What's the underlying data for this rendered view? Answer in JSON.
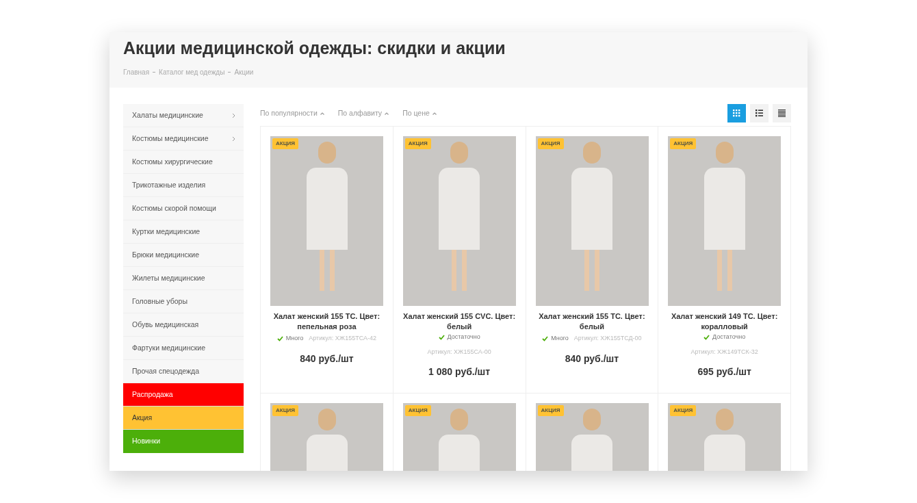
{
  "header": {
    "title": "Акции медицинской одежды: скидки и акции",
    "breadcrumbs": [
      "Главная",
      "Каталог мед одежды",
      "Акции"
    ]
  },
  "sidebar": {
    "items": [
      {
        "label": "Халаты медицинские",
        "kind": "plain",
        "has_submenu": true
      },
      {
        "label": "Костюмы медицинские",
        "kind": "plain",
        "has_submenu": true
      },
      {
        "label": "Костюмы хирургические",
        "kind": "plain",
        "has_submenu": false
      },
      {
        "label": "Трикотажные изделия",
        "kind": "plain",
        "has_submenu": false
      },
      {
        "label": "Костюмы скорой помощи",
        "kind": "plain",
        "has_submenu": false
      },
      {
        "label": "Куртки медицинские",
        "kind": "plain",
        "has_submenu": false
      },
      {
        "label": "Брюки медицинские",
        "kind": "plain",
        "has_submenu": false
      },
      {
        "label": "Жилеты медицинские",
        "kind": "plain",
        "has_submenu": false
      },
      {
        "label": "Головные уборы",
        "kind": "plain",
        "has_submenu": false
      },
      {
        "label": "Обувь медицинская",
        "kind": "plain",
        "has_submenu": false
      },
      {
        "label": "Фартуки медицинские",
        "kind": "plain",
        "has_submenu": false
      },
      {
        "label": "Прочая спецодежда",
        "kind": "plain",
        "has_submenu": false
      },
      {
        "label": "Распродажа",
        "kind": "sale",
        "has_submenu": false
      },
      {
        "label": "Акция",
        "kind": "promo",
        "has_submenu": false
      },
      {
        "label": "Новинки",
        "kind": "new",
        "has_submenu": false
      }
    ]
  },
  "sort_options": [
    {
      "label": "По популярности"
    },
    {
      "label": "По алфавиту"
    },
    {
      "label": "По цене"
    }
  ],
  "view_modes": [
    {
      "kind": "grid",
      "selected": true
    },
    {
      "kind": "list",
      "selected": false
    },
    {
      "kind": "table",
      "selected": false
    }
  ],
  "products": [
    {
      "badge": "АКЦИЯ",
      "kind": "inline",
      "title": "Халат женский 155 ТС. Цвет: пепельная роза",
      "stock": "Много",
      "article": "Артикул: ХЖ155ТСА-42",
      "price": "840 руб./шт"
    },
    {
      "badge": "АКЦИЯ",
      "kind": "stacked",
      "title": "Халат женский 155 CVC. Цвет: белый",
      "stock": "Достаточно",
      "article": "Артикул: ХЖ155СА-00",
      "price": "1 080 руб./шт"
    },
    {
      "badge": "АКЦИЯ",
      "kind": "inline",
      "title": "Халат женский 155 ТС. Цвет: белый",
      "stock": "Много",
      "article": "Артикул: ХЖ155ТСД-00",
      "price": "840 руб./шт"
    },
    {
      "badge": "АКЦИЯ",
      "kind": "stacked",
      "title": "Халат женский 149 ТС. Цвет: коралловый",
      "stock": "Достаточно",
      "article": "Артикул: ХЖ149ТСК-32",
      "price": "695 руб./шт"
    },
    {
      "badge": "АКЦИЯ",
      "kind": "cut"
    },
    {
      "badge": "АКЦИЯ",
      "kind": "cut"
    },
    {
      "badge": "АКЦИЯ",
      "kind": "cut"
    },
    {
      "badge": "АКЦИЯ",
      "kind": "cut"
    }
  ]
}
